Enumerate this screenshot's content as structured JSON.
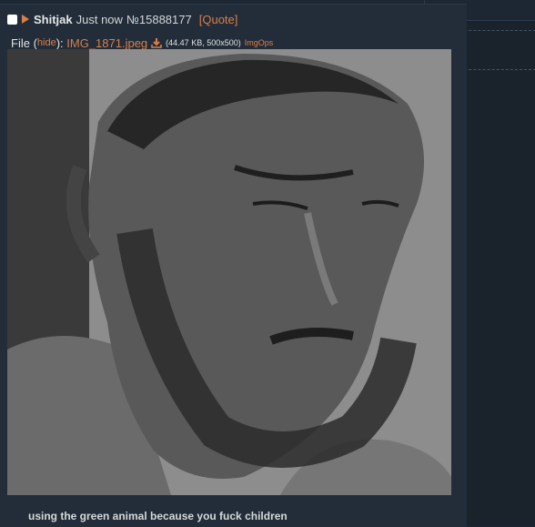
{
  "post": {
    "name": "Shitjak",
    "time": "Just now",
    "number": "№15888177",
    "quote_label": "[Quote]",
    "file_label": "File",
    "hide_label": "hide",
    "filename": "IMG_1871.jpeg",
    "file_meta": "(44.47 KB, 500x500)",
    "imgops_label": "ImgOps",
    "comment": "using the green animal because you fuck children"
  },
  "colors": {
    "accent": "#d97f4a",
    "background": "#1d2733",
    "post_bg": "#222d39"
  },
  "icons": {
    "expand": "triangle-right-icon",
    "download": "download-icon"
  }
}
